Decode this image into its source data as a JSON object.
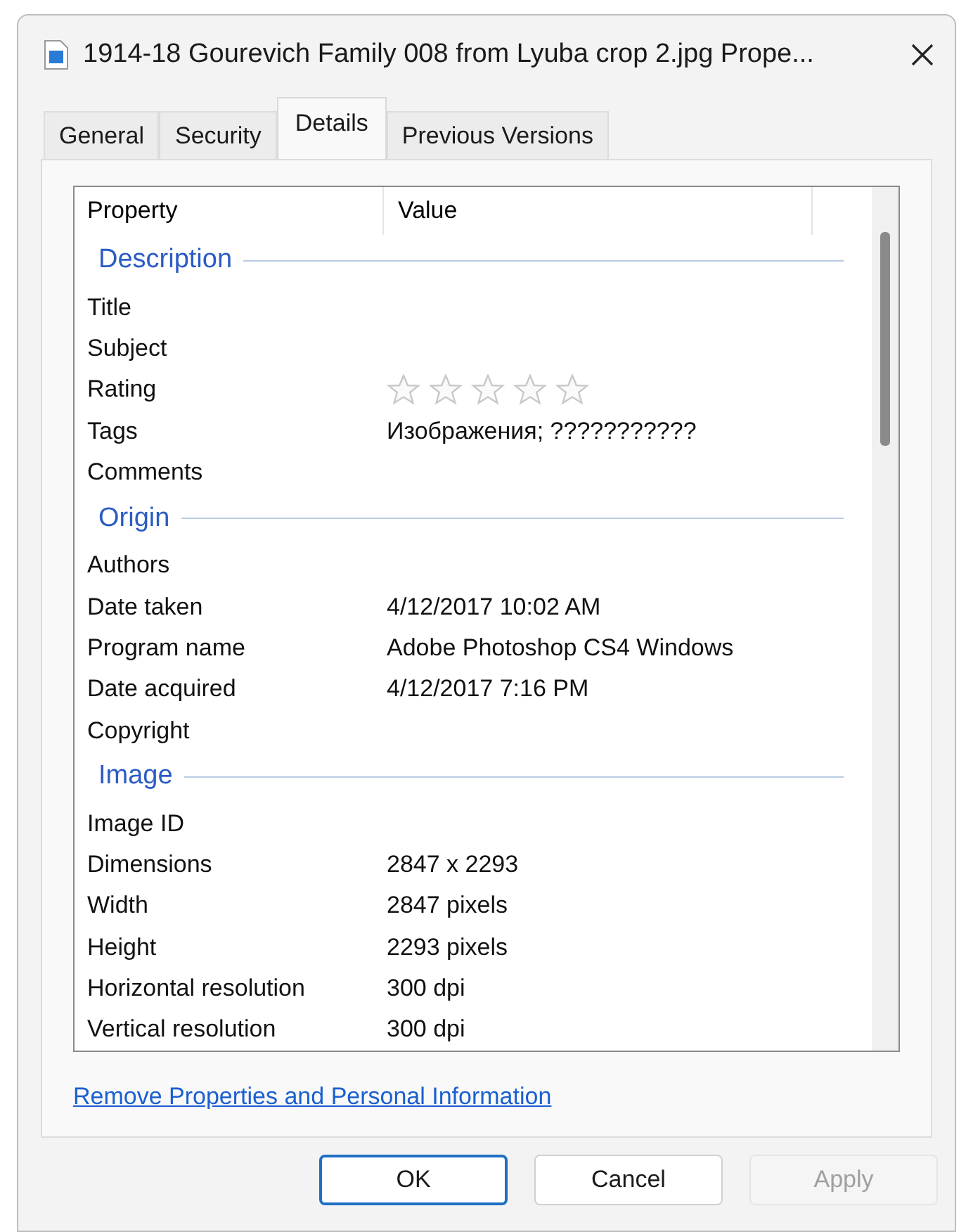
{
  "window": {
    "title": "1914-18 Gourevich Family 008 from Lyuba crop 2.jpg Prope..."
  },
  "tabs": [
    {
      "label": "General",
      "selected": false
    },
    {
      "label": "Security",
      "selected": false
    },
    {
      "label": "Details",
      "selected": true
    },
    {
      "label": "Previous Versions",
      "selected": false
    }
  ],
  "table": {
    "columns": [
      "Property",
      "Value"
    ],
    "sections": [
      {
        "title": "Description",
        "rows": [
          {
            "property": "Title"
          },
          {
            "property": "Subject"
          },
          {
            "property": "Rating",
            "kind": "stars",
            "stars": 0
          },
          {
            "property": "Tags",
            "value": "Изображения; ???????????"
          },
          {
            "property": "Comments"
          }
        ]
      },
      {
        "title": "Origin",
        "rows": [
          {
            "property": "Authors"
          },
          {
            "property": "Date taken",
            "value": "4/12/2017 10:02 AM"
          },
          {
            "property": "Program name",
            "value": "Adobe Photoshop CS4 Windows"
          },
          {
            "property": "Date acquired",
            "value": "4/12/2017 7:16 PM"
          },
          {
            "property": "Copyright"
          }
        ]
      },
      {
        "title": "Image",
        "rows": [
          {
            "property": "Image ID"
          },
          {
            "property": "Dimensions",
            "value": "2847 x 2293"
          },
          {
            "property": "Width",
            "value": "2847 pixels"
          },
          {
            "property": "Height",
            "value": "2293 pixels"
          },
          {
            "property": "Horizontal resolution",
            "value": "300 dpi"
          },
          {
            "property": "Vertical resolution",
            "value": "300 dpi"
          }
        ]
      }
    ]
  },
  "link": "Remove Properties and Personal Information",
  "buttons": [
    {
      "label": "OK",
      "disabled": false,
      "default": true
    },
    {
      "label": "Cancel",
      "disabled": false,
      "default": false
    },
    {
      "label": "Apply",
      "disabled": true,
      "default": false
    }
  ]
}
